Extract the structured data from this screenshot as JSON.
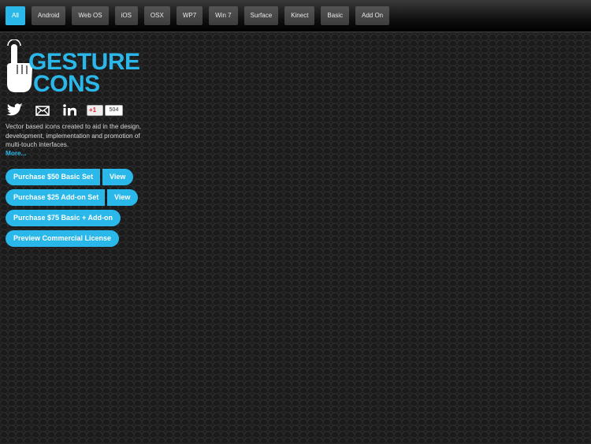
{
  "nav": {
    "items": [
      "All",
      "Android",
      "Web OS",
      "iOS",
      "OSX",
      "WP7",
      "Win 7",
      "Surface",
      "Kinect",
      "Basic",
      "Add On"
    ],
    "active": "All"
  },
  "logo": {
    "line1": "GESTURE",
    "line2": "CONS"
  },
  "social": {
    "gplus_label": "+1",
    "gplus_count": "504"
  },
  "description": "Vector based icons created to aid in the design, development, implementation and promotion of multi-touch interfaces.",
  "more_link": "More...",
  "buttons": {
    "purchase_basic": "Purchase $50 Basic Set",
    "view_basic": "View",
    "purchase_addon": "Purchase $25 Add-on Set",
    "view_addon": "View",
    "purchase_bundle": "Purchase $75 Basic + Add-on",
    "preview_license": "Preview Commercial License"
  },
  "colors": {
    "accent": "#2ab8ea",
    "background": "#1b1b1b"
  }
}
